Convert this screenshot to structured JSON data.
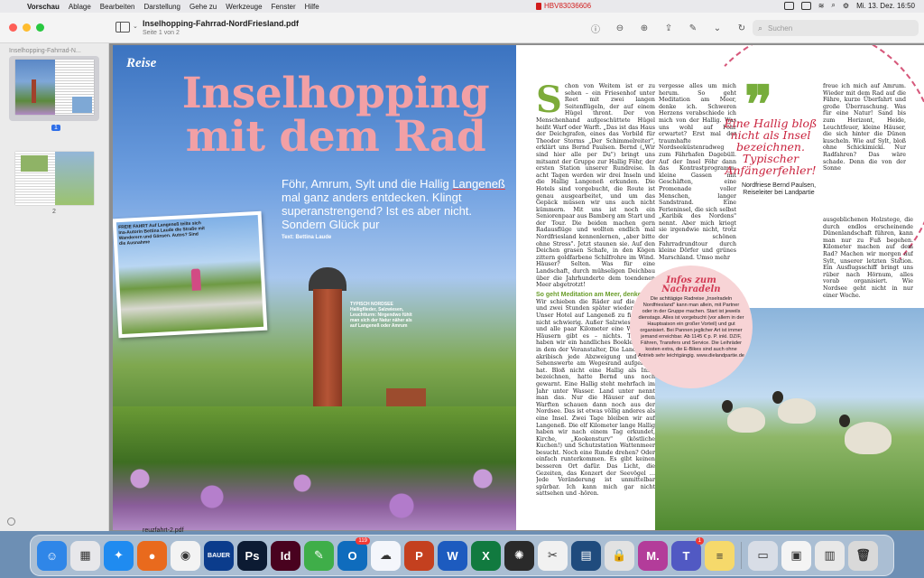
{
  "menubar": {
    "app_name": "Vorschau",
    "menus": [
      "Ablage",
      "Bearbeiten",
      "Darstellung",
      "Gehe zu",
      "Werkzeuge",
      "Fenster",
      "Hilfe"
    ],
    "recording_label": "HBV83036606",
    "datetime": "Mi. 13. Dez. 16:50"
  },
  "window": {
    "title": "Inselhopping-Fahrrad-NordFriesland.pdf",
    "subtitle": "Seite 1 von 2",
    "search_placeholder": "Suchen"
  },
  "sidebar": {
    "title": "Inselhopping-Fahrrad-N...",
    "pages": [
      {
        "label": "1",
        "selected": true
      },
      {
        "label": "2",
        "selected": false
      }
    ]
  },
  "page1": {
    "section": "Reise",
    "headline_line1": "Inselhopping",
    "headline_line2": "mit dem Rad",
    "subhead_pre": "Föhr, Amrum, Sylt und die Hallig ",
    "subhead_ul": "Langeneß",
    "subhead_post": " mal ganz anders entdecken. Klingt superanstrengend? Ist es aber nicht. Sondern Glück pur",
    "byline": "Text: Bettina Laude",
    "photo_caption": "FREIE FAHRT Auf Langeneß teilte sich Ina-Autorin Bettina Laude die Straße mit Wanderern und Gänsen. Autos? Sind die Ausnahme",
    "lighthouse_caption": "TYPISCH NORDSEE Halligflieder, Salzwiesen, Leuchtturm: Nirgendwo fühlt man sich der Natur näher als auf Langeneß oder Amrum"
  },
  "page2": {
    "dropcap": "S",
    "col1_text": "chon von Weitem ist er zu sehen – ein Friesenhof unter Reet mit zwei langen Seitenflügeln, der auf einem Hügel thront. Der von Menschenhand aufgeschüttete Hügel heißt Warf oder Warft. „Das ist das Haus der Deichgrafen, eines das Vorbild für Theodor Storms „Der Schimmelreiter\", erklärt uns Bernd Paulsen. Bernd („Wir sind hier alle per Du\") bringt uns mitsamt der Gruppe zur Hallig Föhr, der ersten Station unserer Rundreise. In acht Tagen werden wir drei Inseln und die Hallig Langeneß erkunden. Die Hotels sind vorgebucht, die Route ist genau ausgearbeitet, und um das Gepäck müssen wir uns auch nicht kümmern. Mit uns ist noch ein Seniorenpaar aus Bamberg am Start und der Tour. Die beiden machen gern Radausflüge und wollten endlich mal Nordfriesland kennenlernen, „aber bitte ohne Stress\". Jetzt staunen sie. Auf den Deichen grasen Schafe, in den Kögen zittern goldfarbene Schilfrohre im Wind. Häuser? Selten. Was für eine Landschaft, durch mühseligen Deichbau über die Jahrhunderte dem toendenen Meer abgetrotzt!",
    "col1_head": "So geht Meditation am Meer, denke ich",
    "col1_text2": "Wir schieben die Räder auf die Fähre und zwei Stunden später wieder runter. Unser Hotel auf Langeneß zu finden ist nicht schwierig. Außer Salzwiesen, Watt und alle paar Kilometer eine Warft mit Häusern gibt es – nichts. Trotzdem haben wir ein handliches Booklet dabei, in dem der Veranstalter, Die Landpartie, akribisch jede Abzweigung und alles Sehenswerte am Wegesrand aufgelistet hat. Bloß nicht eine Hallig als Insel bezeichnen, hatte Bernd uns noch gewarnt. Eine Hallig steht mehrfach im Jahr unter Wasser. Land unter nennt man das. Nur die Häuser auf den Warften schauen dann noch aus der Nordsee. Das ist etwas völlig anderes als eine Insel. Zwei Tage bleiben wir auf Langeneß. Die elf Kilometer lange Hallig haben wir nach einem Tag erkundet, Kirche, „Kookensturv\" (köstliche Kuchen!) und Schutzstation Wattenmeer besucht. Noch eine Runde drehen? Oder einfach runterkommen. Es gibt keinen besseren Ort dafür. Das Licht, die Gezeiten, das Konzert der Seevögel … Jede Veränderung ist unmittelbar spürbar. Ich kann mich gar nicht sattsehen und -hören.",
    "col2_text": "vergesse alles um mich herum. So geht Meditation am Meer, denke ich. Schweren Herzens verabschiede ich mich von der Hallig. Was uns wohl auf Föhr erwartet? Erst mal der traumhafte Nordseeküstenradweg zum Fährhafen Dagebüll. Auf der Insel Föhr dann das Kontrastprogramm: kleine Gassen mit Geschäften, eine Promenade voller Menschen, langer Sandstrand. Eine Ferieninsel, die sich selbst „Karibik des Nordens\" nennt. Aber mich kriegt sie irgendwie nicht, trotz der schönen Fahrradrundtour durch kleine Dörfer und grünes Marschland. Umso mehr",
    "quote_mark": "❞",
    "quote_text": "Eine Hallig bloß nicht als Insel bezeichnen. Typischer Anfängerfehler!",
    "quote_attr": "Nordfriese Bernd Paulsen, Reiseleiter bei Landpartie",
    "col3_text": "freue ich mich auf Amrum. Wieder mit dem Rad auf die Fähre, kurze Überfahrt und große Überraschung. Was für eine Natur! Sand bis zum Horizont, Heide, Leuchtfeuer, kleine Häuser, die sich hinter die Dünen kuscheln. Wie auf Sylt, bloß ohne Schickimicki. Nur Radfahren? Das wäre schade. Denn die von der Sonne",
    "col4_text": "ausgeblichenen Holzstege, die durch endlos erscheinende Dünenlandschaft führen, kann man nur zu Fuß begehen. Kilometer machen auf dem Rad? Machen wir morgen auf Sylt, unserer letzten Station. Ein Ausflugsschiff bringt uns rüber nach Hörnum, alles vorab organisiert. Wie Nordsee geht nicht in nur einer Woche.",
    "info_title": "Infos zum Nachradeln",
    "info_text": "Die achttägige Radreise „Inselradeln Nordfriesland\" kann man allein, mit Partner oder in der Gruppe machen. Start ist jeweils dienstags. Alles ist vorgebucht (vor allem in der Hauptsaison ein großer Vorteil) und gut organisiert. Bei Pannen jeglicher Art ist immer jemand erreichbar. Ab 1145 € p. P. inkl. DZ/F, Fähren, Transfers und Service. Die Leihräder kosten extra, die E-Bikes sind auch ohne Antrieb sehr leichtgängig. www.dielandpartie.de"
  },
  "dock": {
    "hint_label": "reuzfahrt-2.pdf",
    "apps": [
      {
        "name": "finder",
        "glyph": "☺",
        "color": "#2f86e8"
      },
      {
        "name": "launchpad",
        "glyph": "▦",
        "color": "#e7e7ea"
      },
      {
        "name": "safari",
        "glyph": "✦",
        "color": "#1f8bf0"
      },
      {
        "name": "firefox",
        "glyph": "●",
        "color": "#e96a1d"
      },
      {
        "name": "chrome",
        "glyph": "◉",
        "color": "#f3f3f3"
      },
      {
        "name": "bauer",
        "glyph": "BAUER",
        "color": "#0b3c8c"
      },
      {
        "name": "photoshop",
        "glyph": "Ps",
        "color": "#0c1b33"
      },
      {
        "name": "indesign",
        "glyph": "Id",
        "color": "#49021f"
      },
      {
        "name": "pencil",
        "glyph": "✎",
        "color": "#3fae49"
      },
      {
        "name": "outlook",
        "glyph": "O",
        "color": "#0f6cbd",
        "badge": "119"
      },
      {
        "name": "onedrive",
        "glyph": "☁",
        "color": "#f4f6fb"
      },
      {
        "name": "powerpoint",
        "glyph": "P",
        "color": "#c4401f"
      },
      {
        "name": "word",
        "glyph": "W",
        "color": "#1d5bbf"
      },
      {
        "name": "excel",
        "glyph": "X",
        "color": "#117a3f"
      },
      {
        "name": "color-wheel",
        "glyph": "✺",
        "color": "#2a2a2a"
      },
      {
        "name": "scissors",
        "glyph": "✂",
        "color": "#f1f1f1"
      },
      {
        "name": "archive",
        "glyph": "▤",
        "color": "#1f4b7d"
      },
      {
        "name": "lock",
        "glyph": "🔒",
        "color": "#e2e2e2"
      },
      {
        "name": "mail-m",
        "glyph": "M.",
        "color": "#b33c9a"
      },
      {
        "name": "teams",
        "glyph": "T",
        "color": "#5159c3",
        "badge": "1"
      },
      {
        "name": "notes",
        "glyph": "≡",
        "color": "#f6d96b"
      },
      {
        "name": "screen",
        "glyph": "▭",
        "color": "#d8dde6"
      },
      {
        "name": "preview",
        "glyph": "▣",
        "color": "#f4f4f4"
      },
      {
        "name": "downloads",
        "glyph": "▥",
        "color": "#e8e8e8"
      },
      {
        "name": "trash",
        "glyph": "🗑",
        "color": "#d9d9d9"
      }
    ]
  },
  "colors": {
    "headline": "#f2a0a5",
    "accent_green": "#7dab3a",
    "quote_red": "#c9213c",
    "info_bg": "#f7d4d6"
  }
}
